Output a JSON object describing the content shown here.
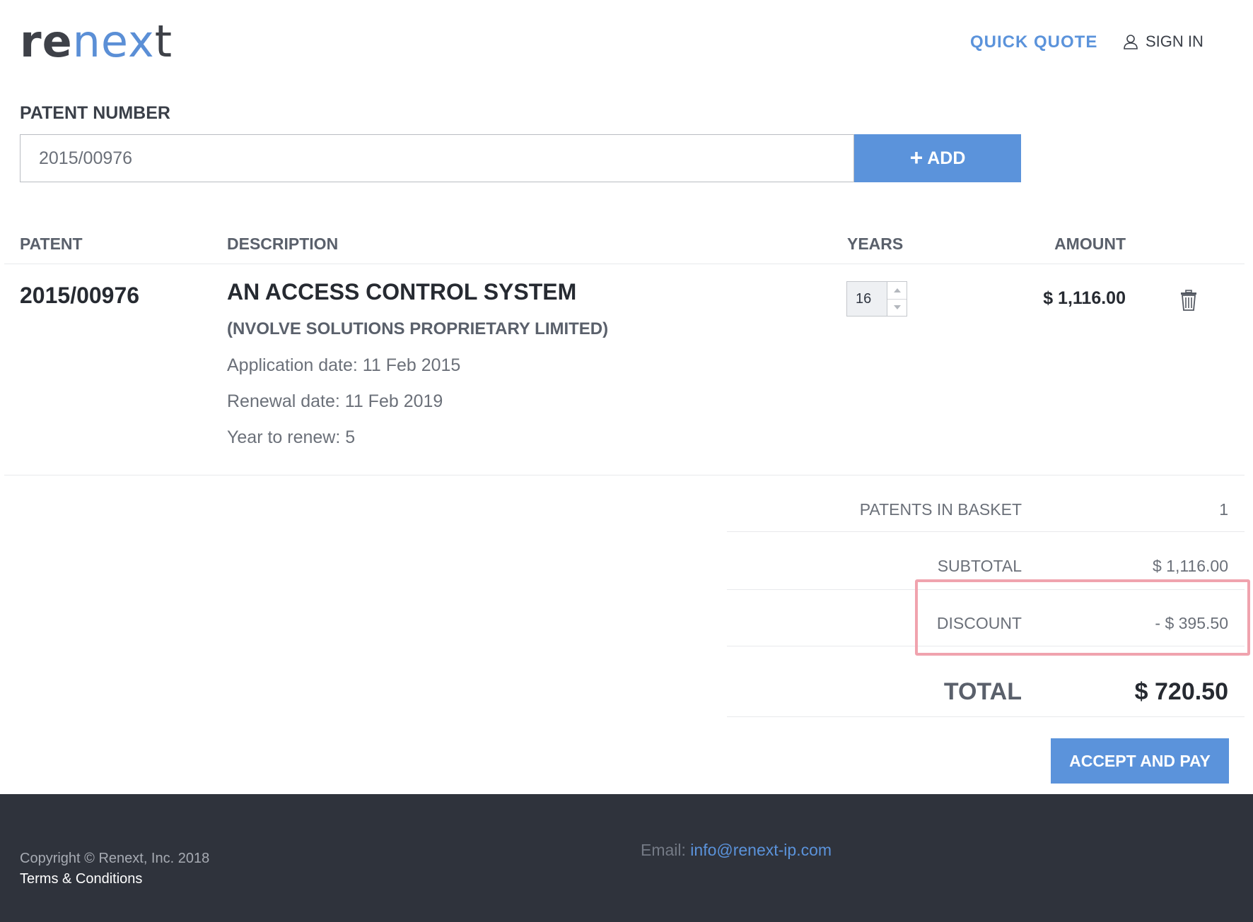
{
  "header": {
    "logo": {
      "part1": "re",
      "part2": "nex",
      "part3": "t"
    },
    "quick_quote": "QUICK QUOTE",
    "sign_in": "SIGN IN",
    "sign_in_icon": "user-icon"
  },
  "patent_input": {
    "label": "PATENT NUMBER",
    "value": "2015/00976",
    "add_label": "ADD",
    "add_icon": "plus-icon"
  },
  "table": {
    "headers": {
      "patent": "PATENT",
      "description": "DESCRIPTION",
      "years": "YEARS",
      "amount": "AMOUNT"
    },
    "rows": [
      {
        "patent": "2015/00976",
        "title": "AN ACCESS CONTROL SYSTEM",
        "owner": "(NVOLVE SOLUTIONS PROPRIETARY LIMITED)",
        "application_date": "Application date: 11 Feb 2015",
        "renewal_date": "Renewal date: 11 Feb 2019",
        "year_to_renew": "Year to renew: 5",
        "years": "16",
        "amount": "$ 1,116.00",
        "delete_icon": "trash-icon"
      }
    ]
  },
  "summary": {
    "patents_in_basket_label": "PATENTS IN BASKET",
    "patents_in_basket_value": "1",
    "subtotal_label": "SUBTOTAL",
    "subtotal_value": "$ 1,116.00",
    "discount_label": "DISCOUNT",
    "discount_value": "- $ 395.50",
    "total_label": "TOTAL",
    "total_value": "$ 720.50",
    "pay_button": "ACCEPT AND PAY",
    "highlight_color": "#f0a3ae"
  },
  "footer": {
    "copyright": "Copyright © Renext, Inc. 2018",
    "terms": "Terms & Conditions",
    "email_label": "Email:",
    "email": "info@renext-ip.com"
  },
  "colors": {
    "accent": "#5b93db",
    "footer_bg": "#2f333c",
    "text_dark": "#262a31"
  }
}
